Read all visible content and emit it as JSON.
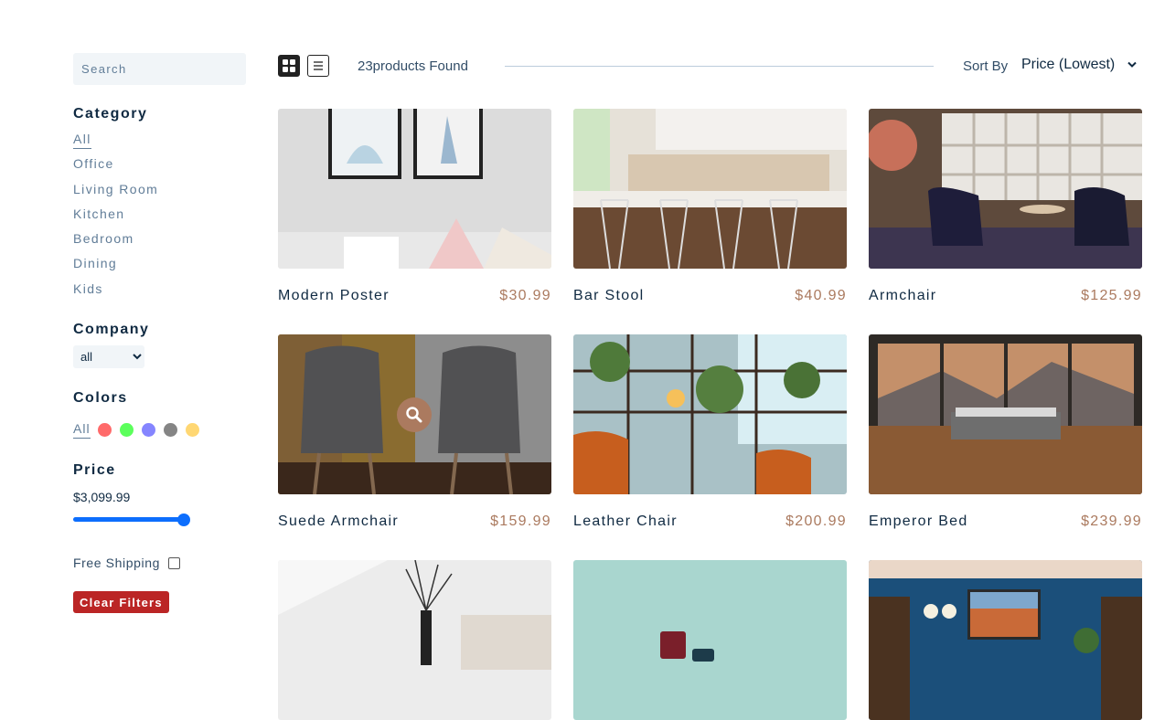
{
  "sidebar": {
    "search_placeholder": "Search",
    "category_title": "Category",
    "categories": [
      "All",
      "Office",
      "Living Room",
      "Kitchen",
      "Bedroom",
      "Dining",
      "Kids"
    ],
    "company_title": "Company",
    "company_selected": "all",
    "colors_title": "Colors",
    "colors_all": "All",
    "colors": [
      "#ff5050",
      "#40ff40",
      "#7070ff",
      "#707070",
      "#ffd05a"
    ],
    "price_title": "Price",
    "price_value": "$3,099.99",
    "price_level_fraction": 1.0,
    "free_shipping_label": "Free Shipping",
    "free_shipping_checked": false,
    "clear_label": "Clear Filters"
  },
  "toolbar": {
    "count_text": "23products Found",
    "sort_label": "Sort By",
    "sort_selected": "Price (Lowest)"
  },
  "products": [
    {
      "name": "Modern Poster",
      "price": "$30.99"
    },
    {
      "name": "Bar Stool",
      "price": "$40.99"
    },
    {
      "name": "Armchair",
      "price": "$125.99"
    },
    {
      "name": "Suede Armchair",
      "price": "$159.99"
    },
    {
      "name": "Leather Chair",
      "price": "$200.99"
    },
    {
      "name": "Emperor Bed",
      "price": "$239.99"
    },
    {
      "name": "",
      "price": ""
    },
    {
      "name": "",
      "price": ""
    },
    {
      "name": "",
      "price": ""
    }
  ],
  "theme": {
    "accent": "#ab7a5f",
    "primary_dark": "#102a42",
    "clear_button": "#bb2525"
  }
}
